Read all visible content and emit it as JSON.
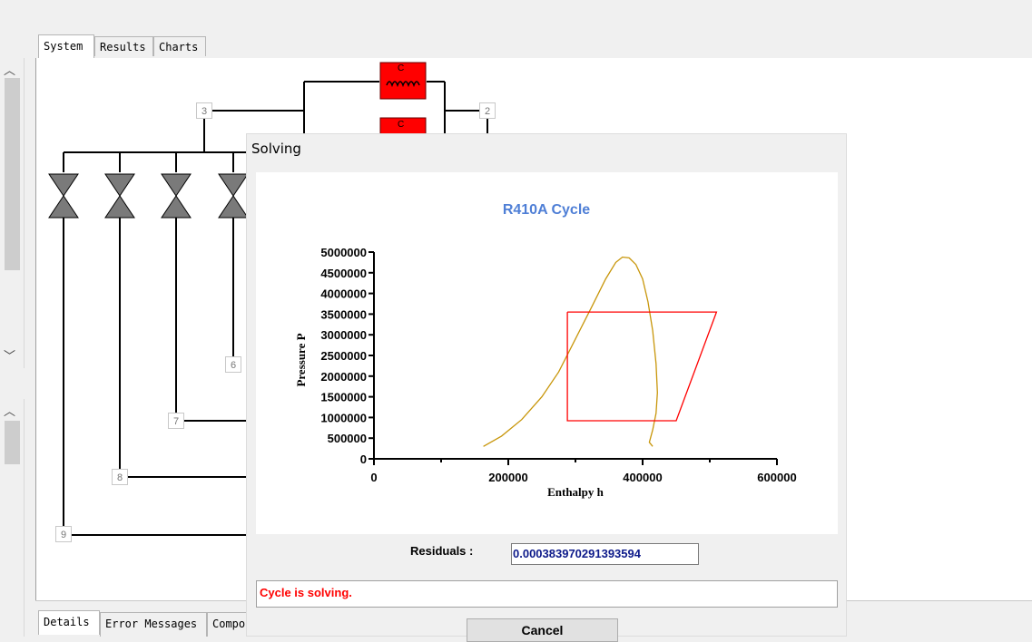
{
  "main_tabs": [
    "System",
    "Results",
    "Charts"
  ],
  "nodes": [
    "3",
    "2",
    "6",
    "7",
    "8",
    "9"
  ],
  "component_label": "C",
  "dialog": {
    "title": "Solving",
    "residuals_label": "Residuals :",
    "residuals_value": "0.000383970291393594",
    "status_message": "Cycle is solving.",
    "cancel_label": "Cancel",
    "status_color": "#ff0000",
    "title_color": "#4f7fd6"
  },
  "bottom_tabs": [
    "Details",
    "Error Messages",
    "Compo"
  ],
  "chart_data": {
    "type": "line",
    "title": "R410A  Cycle",
    "xlabel": "Enthalpy h",
    "ylabel": "Pressure P",
    "xlim": [
      0,
      600000
    ],
    "ylim": [
      0,
      5000000
    ],
    "xticks": [
      "0",
      "200000",
      "400000",
      "600000"
    ],
    "yticks": [
      "0",
      "500000",
      "1000000",
      "1500000",
      "2000000",
      "2500000",
      "3000000",
      "3500000",
      "4000000",
      "4500000",
      "5000000"
    ],
    "series": [
      {
        "color": "#c8960a",
        "x": [
          163000,
          190000,
          220000,
          250000,
          275000,
          300000,
          325000,
          345000,
          360000,
          370000,
          380000,
          390000,
          400000,
          408000,
          415000,
          420000,
          422000,
          420000,
          415000,
          410000,
          415000
        ],
        "y": [
          300000,
          550000,
          950000,
          1500000,
          2100000,
          2900000,
          3700000,
          4350000,
          4750000,
          4880000,
          4860000,
          4700000,
          4350000,
          3800000,
          3100000,
          2300000,
          1600000,
          1100000,
          700000,
          400000,
          300000
        ]
      },
      {
        "color": "#ff0000",
        "x": [
          288000,
          288000,
          510000,
          450000,
          288000
        ],
        "y": [
          3550000,
          920000,
          920000,
          3550000,
          3550000
        ],
        "closed_x": [
          288000,
          510000,
          450000,
          288000,
          288000
        ],
        "closed_y": [
          3550000,
          3550000,
          920000,
          920000,
          3550000
        ]
      }
    ]
  }
}
